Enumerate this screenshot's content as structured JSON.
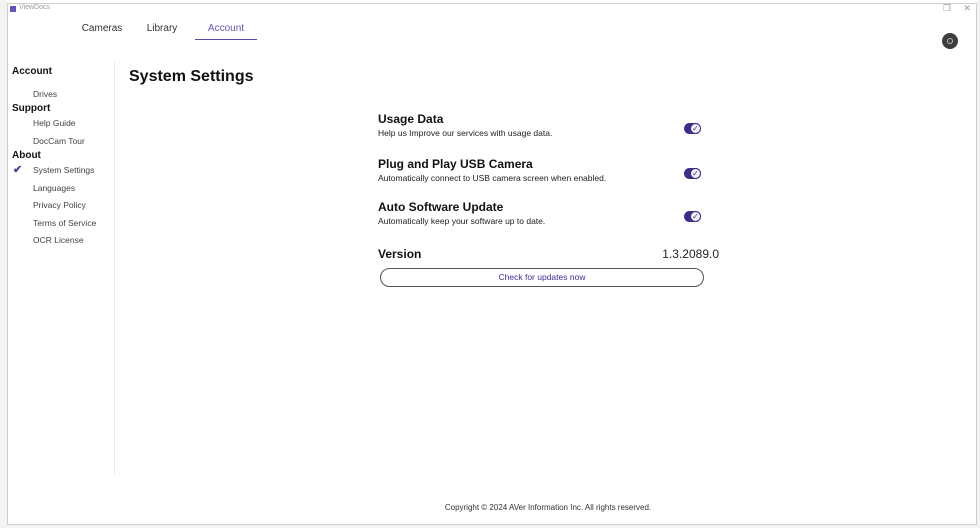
{
  "window": {
    "app_title": "ViewDocs",
    "restore_glyph": "❐",
    "close_glyph": "✕"
  },
  "topnav": {
    "tabs": [
      {
        "label": "Cameras",
        "active": false
      },
      {
        "label": "Library",
        "active": false
      },
      {
        "label": "Account",
        "active": true
      }
    ]
  },
  "avatar": {
    "icon": "user-avatar-icon"
  },
  "sidebar": {
    "sections": [
      {
        "title": "Account",
        "items": [
          "Drives"
        ]
      },
      {
        "title": "Support",
        "items": [
          "Help Guide",
          "DocCam Tour"
        ]
      },
      {
        "title": "About",
        "items": [
          "System Settings",
          "Languages",
          "Privacy Policy",
          "Terms of Service",
          "OCR License"
        ]
      }
    ],
    "selected_item": "System Settings",
    "check_glyph": "✔"
  },
  "main": {
    "title": "System Settings",
    "settings": [
      {
        "title": "Usage Data",
        "description": "Help us Improve our services with usage data.",
        "enabled": true
      },
      {
        "title": "Plug and Play USB Camera",
        "description": "Automatically connect to USB camera screen when enabled.",
        "enabled": true
      },
      {
        "title": "Auto Software Update",
        "description": "Automatically keep your software up to date.",
        "enabled": true
      }
    ],
    "version_label": "Version",
    "version_value": "1.3.2089.0",
    "check_button_label": "Check for updates now"
  },
  "footer": {
    "copyright": "Copyright © 2024 AVer Information Inc. All rights reserved."
  },
  "colors": {
    "accent": "#5a4aa8",
    "toggle_on": "#3a2f86"
  }
}
